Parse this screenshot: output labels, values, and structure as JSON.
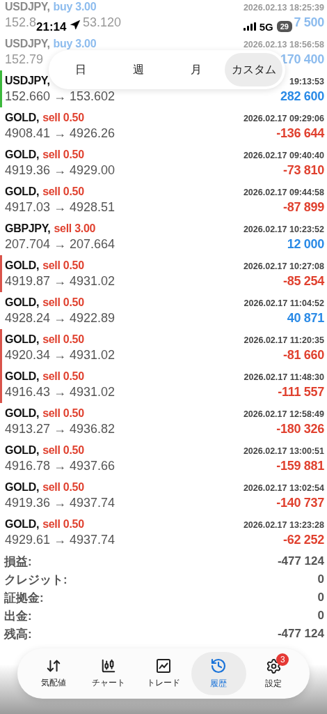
{
  "status_bar": {
    "time": "21:14",
    "network": "5G",
    "battery": "29"
  },
  "period_tabs": [
    {
      "label": "日",
      "selected": false
    },
    {
      "label": "週",
      "selected": false
    },
    {
      "label": "月",
      "selected": false
    },
    {
      "label": "カスタム",
      "selected": true
    }
  ],
  "trades": [
    {
      "symbol": "USDJPY,",
      "side": {
        "text": "buy 3.00",
        "color": "#8dbcee"
      },
      "time": "2026.02.13 18:25:39",
      "prices": "152.8",
      "prices_tail": "53.120",
      "profit": {
        "text": "7 500",
        "color": "#8dbcee"
      },
      "faded": true
    },
    {
      "symbol": "USDJPY,",
      "side": {
        "text": "buy 3.00",
        "color": "#8dbcee"
      },
      "time": "2026.02.13 18:56:58",
      "prices": "152.79",
      "profit": {
        "text": "170 400",
        "color": "#8dbcee"
      },
      "faded": true
    },
    {
      "symbol": "USDJPY,",
      "time": "19:13:53",
      "prices": "152.660 → 153.602",
      "profit": {
        "text": "282 600",
        "color": "#2a8ae6"
      },
      "color": "#3cb83c",
      "faded": false
    },
    {
      "symbol": "GOLD,",
      "side": {
        "text": "sell 0.50",
        "color": "#e0412f"
      },
      "time": "2026.02.17 09:29:06",
      "prices": "4908.41 → 4926.26",
      "profit": {
        "text": "-136 644",
        "color": "#e0412f"
      },
      "faded": false
    },
    {
      "symbol": "GOLD,",
      "side": {
        "text": "sell 0.50",
        "color": "#e0412f"
      },
      "time": "2026.02.17 09:40:40",
      "prices": "4919.36 → 4929.00",
      "profit": {
        "text": "-73 810",
        "color": "#e0412f"
      },
      "faded": false
    },
    {
      "symbol": "GOLD,",
      "side": {
        "text": "sell 0.50",
        "color": "#e0412f"
      },
      "time": "2026.02.17 09:44:58",
      "prices": "4917.03 → 4928.51",
      "profit": {
        "text": "-87 899",
        "color": "#e0412f"
      },
      "faded": false
    },
    {
      "symbol": "GBPJPY,",
      "side": {
        "text": "sell 3.00",
        "color": "#e0412f"
      },
      "time": "2026.02.17 10:23:52",
      "prices": "207.704 → 207.664",
      "profit": {
        "text": "12 000",
        "color": "#2a8ae6"
      },
      "faded": false
    },
    {
      "symbol": "GOLD,",
      "side": {
        "text": "sell 0.50",
        "color": "#e0412f"
      },
      "time": "2026.02.17 10:27:08",
      "prices": "4919.87 → 4931.02",
      "profit": {
        "text": "-85 254",
        "color": "#e0412f"
      },
      "color": "#d9534a",
      "faded": false
    },
    {
      "symbol": "GOLD,",
      "side": {
        "text": "sell 0.50",
        "color": "#e0412f"
      },
      "time": "2026.02.17 11:04:52",
      "prices": "4928.24 → 4922.89",
      "profit": {
        "text": "40 871",
        "color": "#2a8ae6"
      },
      "faded": false
    },
    {
      "symbol": "GOLD,",
      "side": {
        "text": "sell 0.50",
        "color": "#e0412f"
      },
      "time": "2026.02.17 11:20:35",
      "prices": "4920.34 → 4931.02",
      "profit": {
        "text": "-81 660",
        "color": "#e0412f"
      },
      "color": "#d9534a",
      "faded": false
    },
    {
      "symbol": "GOLD,",
      "side": {
        "text": "sell 0.50",
        "color": "#e0412f"
      },
      "time": "2026.02.17 11:48:30",
      "prices": "4916.43 → 4931.02",
      "profit": {
        "text": "-111 557",
        "color": "#e0412f"
      },
      "color": "#d9534a",
      "faded": false
    },
    {
      "symbol": "GOLD,",
      "side": {
        "text": "sell 0.50",
        "color": "#e0412f"
      },
      "time": "2026.02.17 12:58:49",
      "prices": "4913.27 → 4936.82",
      "profit": {
        "text": "-180 326",
        "color": "#e0412f"
      },
      "faded": false
    },
    {
      "symbol": "GOLD,",
      "side": {
        "text": "sell 0.50",
        "color": "#e0412f"
      },
      "time": "2026.02.17 13:00:51",
      "prices": "4916.78 → 4937.66",
      "profit": {
        "text": "-159 881",
        "color": "#e0412f"
      },
      "faded": false
    },
    {
      "symbol": "GOLD,",
      "side": {
        "text": "sell 0.50",
        "color": "#e0412f"
      },
      "time": "2026.02.17 13:02:54",
      "prices": "4919.36 → 4937.74",
      "profit": {
        "text": "-140 737",
        "color": "#e0412f"
      },
      "faded": false
    },
    {
      "symbol": "GOLD,",
      "side": {
        "text": "sell 0.50",
        "color": "#e0412f"
      },
      "time": "2026.02.17 13:23:28",
      "prices": "4929.61 → 4937.74",
      "profit": {
        "text": "-62 252",
        "color": "#e0412f"
      },
      "faded": false
    }
  ],
  "summary": [
    {
      "label": "損益:",
      "value": "-477 124"
    },
    {
      "label": "クレジット:",
      "value": "0"
    },
    {
      "label": "証拠金:",
      "value": "0"
    },
    {
      "label": "出金:",
      "value": "0"
    },
    {
      "label": "残高:",
      "value": "-477 124"
    }
  ],
  "bottom_nav": [
    {
      "kind": "quotes",
      "label": "気配値",
      "selected": false
    },
    {
      "kind": "chart",
      "label": "チャート",
      "selected": false
    },
    {
      "kind": "trade",
      "label": "トレード",
      "selected": false
    },
    {
      "kind": "history",
      "label": "履歴",
      "selected": true
    },
    {
      "kind": "settings",
      "label": "設定",
      "selected": false,
      "badge": "3"
    }
  ]
}
